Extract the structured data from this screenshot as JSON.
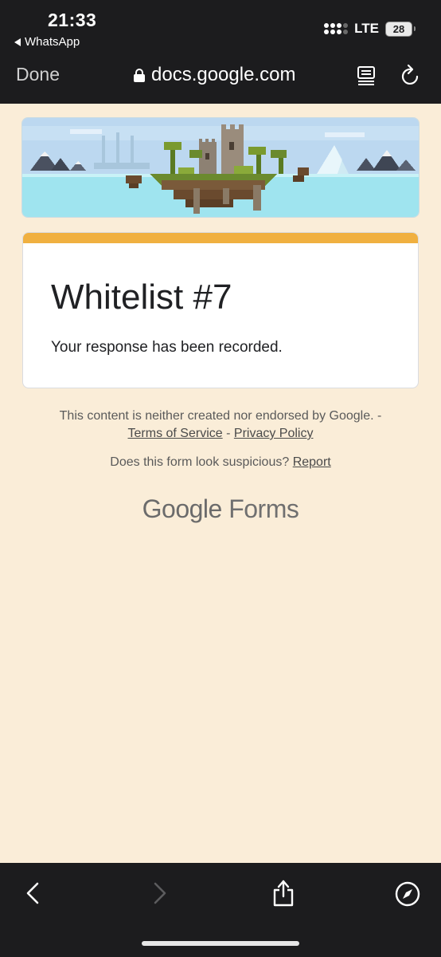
{
  "status_bar": {
    "time": "21:33",
    "back_app": "WhatsApp",
    "network": "LTE",
    "battery": "28"
  },
  "browser": {
    "done_label": "Done",
    "url": "docs.google.com"
  },
  "form": {
    "title": "Whitelist #7",
    "message": "Your response has been recorded.",
    "accent_color": "#f0b040",
    "background_color": "#faedd8"
  },
  "footer": {
    "disclaimer": "This content is neither created nor endorsed by Google. -",
    "terms_label": "Terms of Service",
    "separator": "-",
    "privacy_label": "Privacy Policy",
    "suspicious_text": "Does this form look suspicious?",
    "report_label": "Report",
    "logo_google": "Google",
    "logo_forms": "Forms"
  },
  "icons": {
    "lock": "lock-icon",
    "reader": "reader-icon",
    "reload": "reload-icon",
    "back": "chevron-left-icon",
    "forward": "chevron-right-icon",
    "share": "share-icon",
    "compass": "compass-icon"
  }
}
